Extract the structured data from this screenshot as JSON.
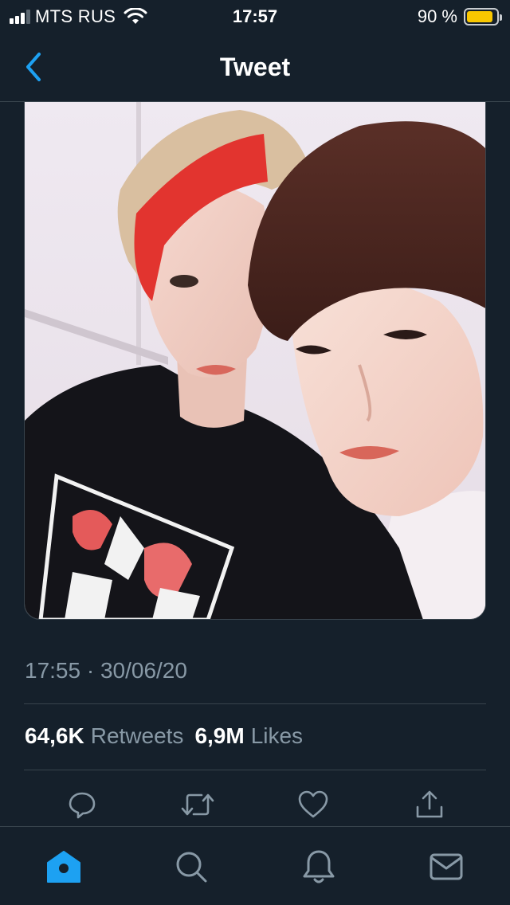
{
  "status_bar": {
    "carrier": "MTS RUS",
    "time": "17:57",
    "battery_percent": "90 %",
    "battery_level": 0.9
  },
  "nav": {
    "title": "Tweet"
  },
  "tweet": {
    "timestamp": "17:55 · 30/06/20",
    "retweets_count": "64,6K",
    "retweets_label": "Retweets",
    "likes_count": "6,9M",
    "likes_label": "Likes"
  },
  "icons": {
    "back": "chevron-left-icon",
    "reply": "speech-bubble-icon",
    "retweet": "retweet-arrows-icon",
    "like": "heart-icon",
    "share": "share-upload-icon",
    "home": "home-icon",
    "search": "search-icon",
    "notifications": "bell-icon",
    "messages": "envelope-icon"
  },
  "colors": {
    "background": "#15202b",
    "accent": "#1da1f2",
    "secondary_text": "#8899a6",
    "divider": "#38444d",
    "battery": "#f9c700"
  }
}
